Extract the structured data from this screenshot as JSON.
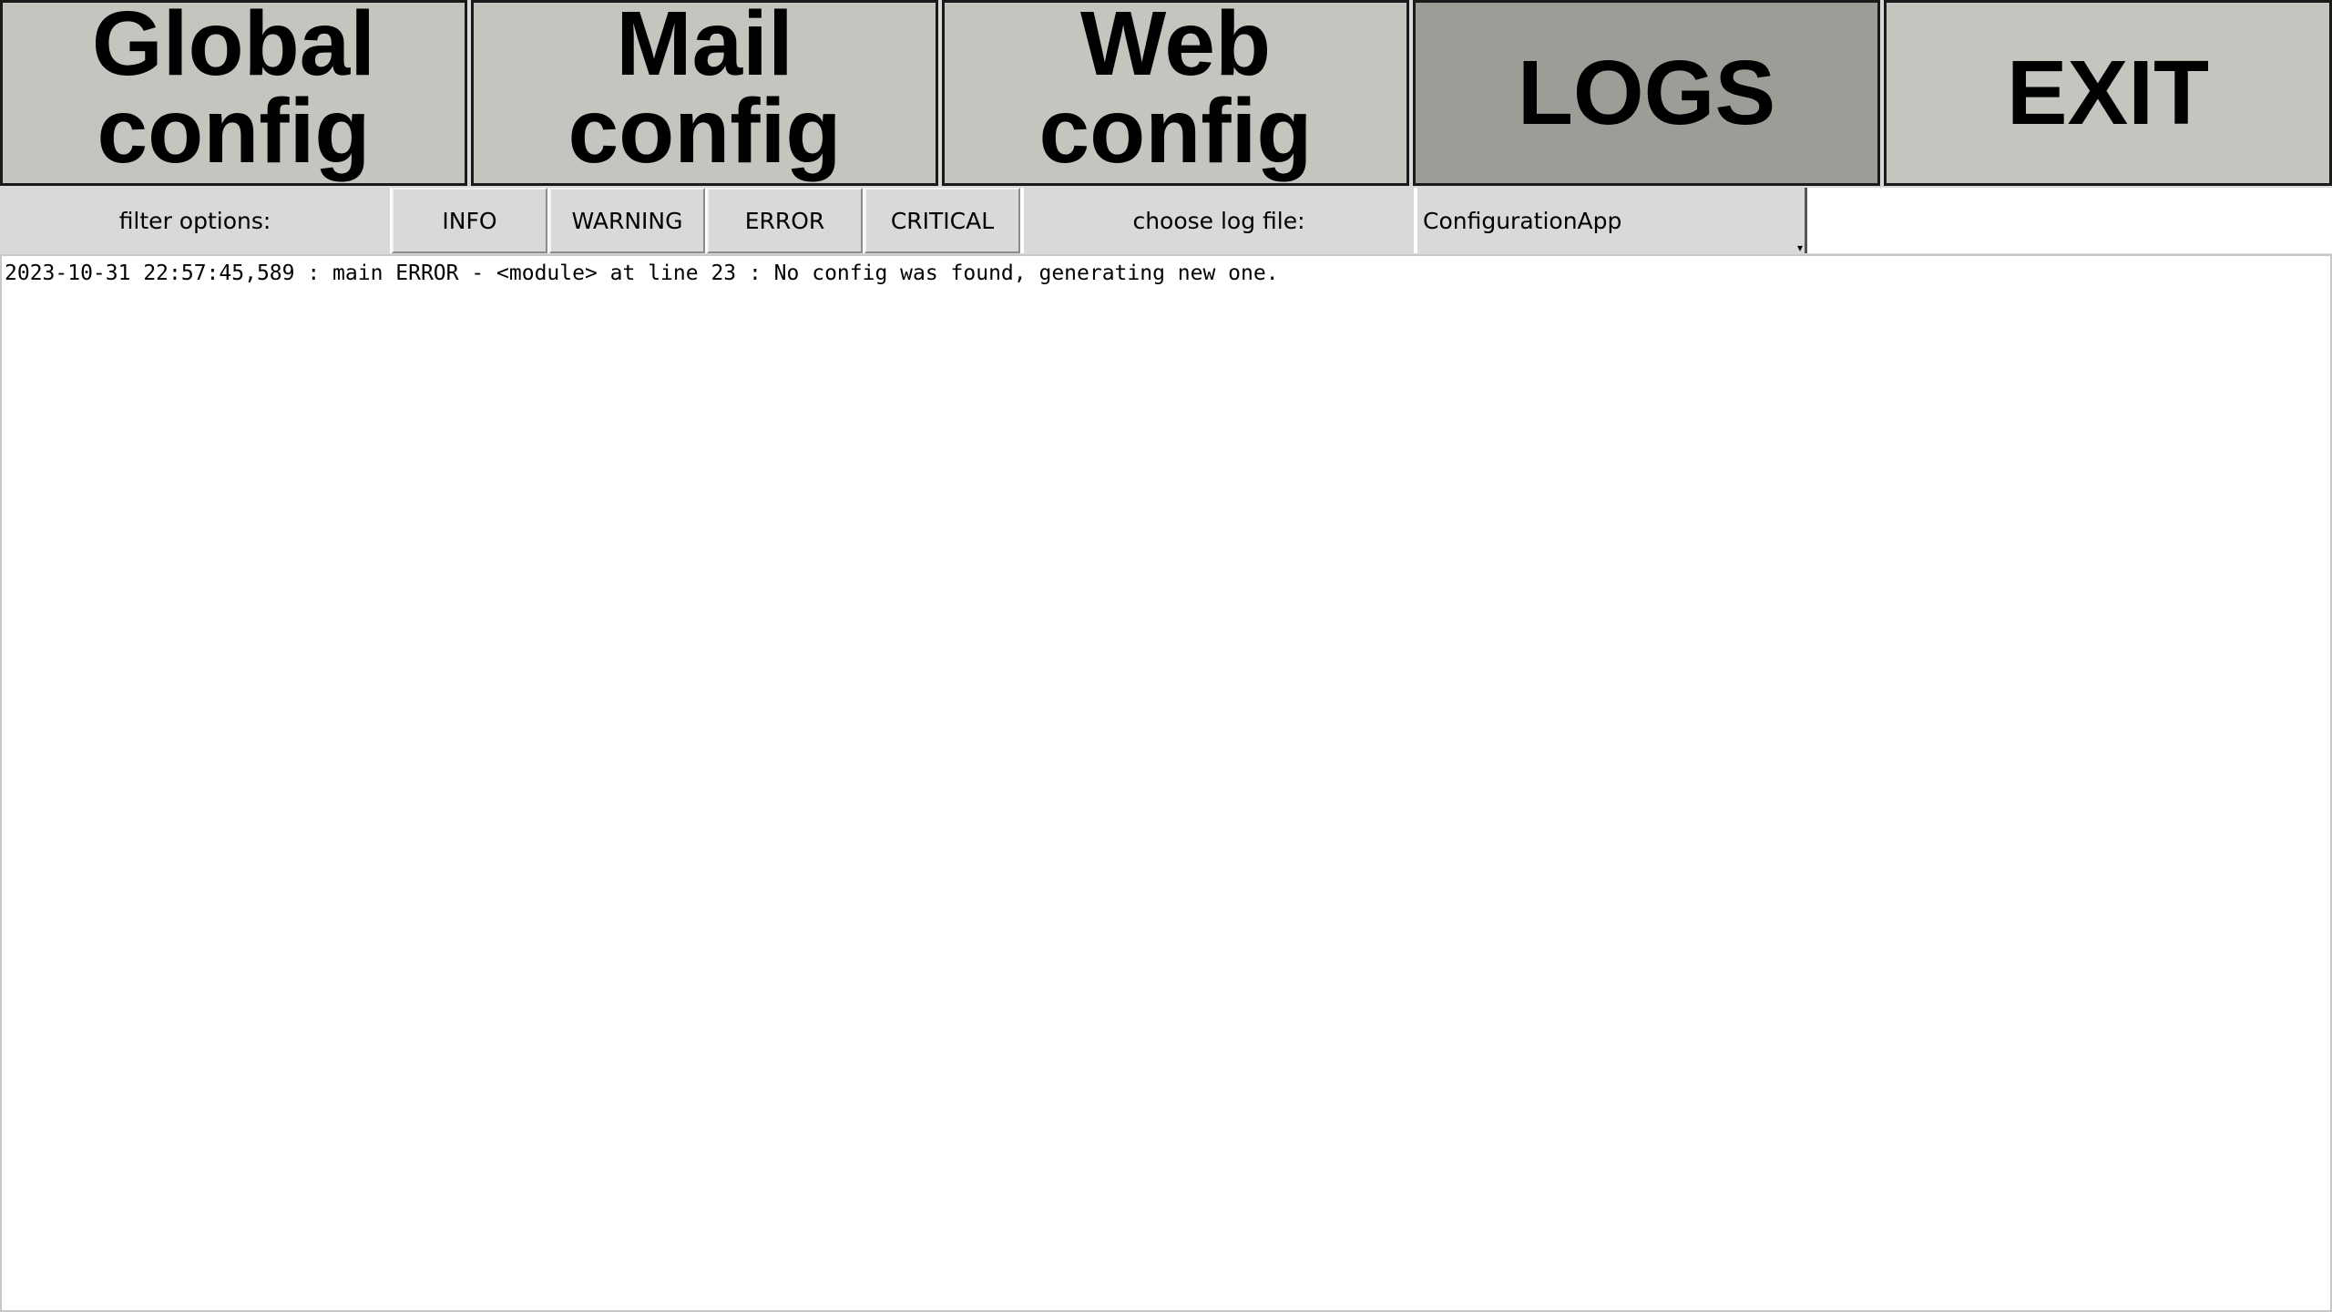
{
  "nav": {
    "global": "Global\nconfig",
    "mail": "Mail\nconfig",
    "web": "Web\nconfig",
    "logs": "LOGS",
    "exit": "EXIT",
    "active": "logs"
  },
  "filters": {
    "label": "filter options:",
    "info": "INFO",
    "warning": "WARNING",
    "error": "ERROR",
    "critical": "CRITICAL"
  },
  "logfile": {
    "label": "choose log file:",
    "selected": "ConfigurationApp"
  },
  "log_lines": [
    "2023-10-31 22:57:45,589 : main ERROR - <module> at line 23 : No config was found, generating new one."
  ],
  "colors": {
    "nav_bg": "#c5c4bf",
    "nav_active_bg": "#9d9c97",
    "bar_bg": "#d9d9d9",
    "log_bg": "#ffffff"
  },
  "icons": {
    "dropdown": "chevron-down-icon"
  }
}
